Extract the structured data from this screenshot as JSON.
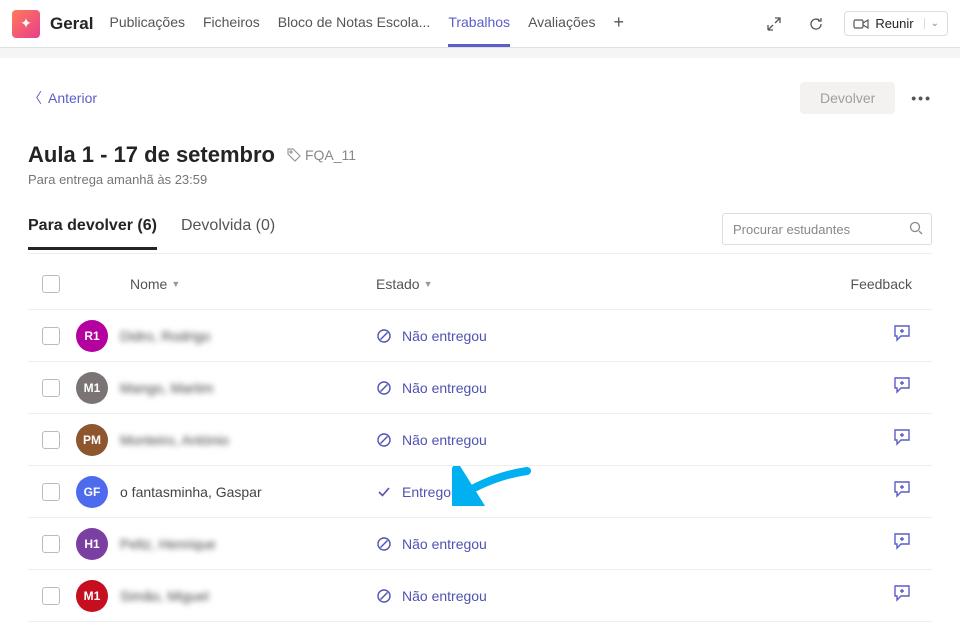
{
  "topbar": {
    "channel_name": "Geral",
    "tabs": [
      {
        "label": "Publicações"
      },
      {
        "label": "Ficheiros"
      },
      {
        "label": "Bloco de Notas Escola..."
      },
      {
        "label": "Trabalhos",
        "active": true
      },
      {
        "label": "Avaliações"
      }
    ],
    "meet_label": "Reunir"
  },
  "page": {
    "back_label": "Anterior",
    "return_label": "Devolver",
    "title": "Aula 1 - 17 de setembro",
    "tag": "FQA_11",
    "due": "Para entrega amanhã às 23:59",
    "subtabs": {
      "to_return": {
        "label": "Para devolver",
        "count": 6
      },
      "returned": {
        "label": "Devolvida",
        "count": 0
      }
    },
    "search_placeholder": "Procurar estudantes",
    "columns": {
      "name": "Nome",
      "state": "Estado",
      "feedback": "Feedback"
    },
    "status_labels": {
      "not_turned_in": "Não entregou",
      "turned_in": "Entregou"
    },
    "students": [
      {
        "initials": "R1",
        "name": "Didro, Rodrigo",
        "status": "not_turned_in",
        "avatar_color": "#b4009e",
        "blurred": true
      },
      {
        "initials": "M1",
        "name": "Mango, Martim",
        "status": "not_turned_in",
        "avatar_color": "#7a7574",
        "blurred": true
      },
      {
        "initials": "PM",
        "name": "Monteiro, António",
        "status": "not_turned_in",
        "avatar_color": "#8e562e",
        "blurred": true
      },
      {
        "initials": "GF",
        "name": "o fantasminha, Gaspar",
        "status": "turned_in",
        "avatar_color": "#4f6bed",
        "blurred": false
      },
      {
        "initials": "H1",
        "name": "Peltz, Henrique",
        "status": "not_turned_in",
        "avatar_color": "#7b3fa1",
        "blurred": true
      },
      {
        "initials": "M1",
        "name": "Simão, Miguel",
        "status": "not_turned_in",
        "avatar_color": "#c50f1f",
        "blurred": true
      }
    ]
  }
}
